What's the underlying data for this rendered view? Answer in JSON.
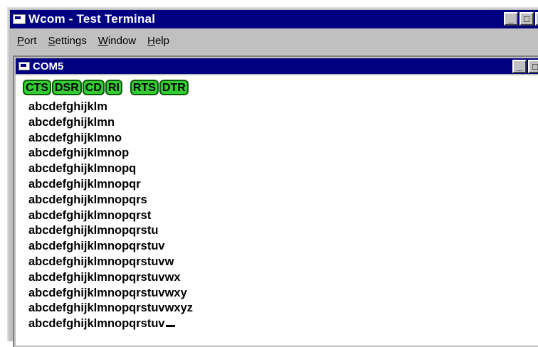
{
  "app": {
    "title": "Wcom - Test Terminal"
  },
  "menu": [
    {
      "first": "P",
      "rest": "ort"
    },
    {
      "first": "S",
      "rest": "ettings"
    },
    {
      "first": "W",
      "rest": "indow"
    },
    {
      "first": "H",
      "rest": "elp"
    }
  ],
  "window_buttons": {
    "minimize": "_",
    "maximize": "□",
    "close": "×"
  },
  "child": {
    "title": "COM5",
    "status": [
      "CTS",
      "DSR",
      "CD",
      "RI",
      "RTS",
      "DTR"
    ],
    "status_color": "#33cc33",
    "lines": [
      "abcdefghijklm",
      "abcdefghijklmn",
      "abcdefghijklmno",
      "abcdefghijklmnop",
      "abcdefghijklmnopq",
      "abcdefghijklmnopqr",
      "abcdefghijklmnopqrs",
      "abcdefghijklmnopqrst",
      "abcdefghijklmnopqrstu",
      "abcdefghijklmnopqrstuv",
      "abcdefghijklmnopqrstuvw",
      "abcdefghijklmnopqrstuvwx",
      "abcdefghijklmnopqrstuvwxy",
      "abcdefghijklmnopqrstuvwxyz",
      "abcdefghijklmnopqrstuv"
    ]
  }
}
